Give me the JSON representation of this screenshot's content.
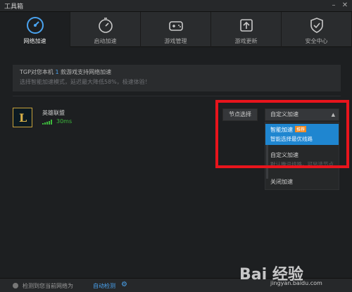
{
  "window": {
    "title": "工具箱"
  },
  "tabs": [
    {
      "label": "网络加速",
      "icon": "speedometer-icon",
      "active": true
    },
    {
      "label": "启动加速",
      "icon": "stopwatch-icon",
      "active": false
    },
    {
      "label": "游戏管理",
      "icon": "gamepad-icon",
      "active": false
    },
    {
      "label": "游戏更新",
      "icon": "update-icon",
      "active": false
    },
    {
      "label": "安全中心",
      "icon": "shield-icon",
      "active": false
    }
  ],
  "notice": {
    "prefix": "TGP对您本机",
    "count": "1",
    "suffix": "款游戏支持网络加速",
    "tip": "选择智能加速模式，延迟最大降低58%，极速体验！"
  },
  "game": {
    "name": "英雄联盟",
    "logo_letter": "L",
    "ping": "30ms",
    "signal_strength": 5
  },
  "node_button": "节点选择",
  "mode_select": {
    "value": "自定义加速",
    "caret": "▲"
  },
  "dropdown": [
    {
      "title": "智能加速",
      "badge": "推荐",
      "desc": "智能选择最优线路"
    },
    {
      "title": "自定义加速",
      "desc": "默认腾讯线路，可另选节点"
    },
    {
      "title": "关闭加速"
    }
  ],
  "status": {
    "text": "检测到您当前网络为",
    "link": "自动检测"
  },
  "watermark": {
    "main": "Bai 经验",
    "sub": "jingyan.baidu.com"
  },
  "colors": {
    "accent": "#1f86d0",
    "highlight_box": "#e8141c",
    "ping_green": "#3dbb3d"
  }
}
